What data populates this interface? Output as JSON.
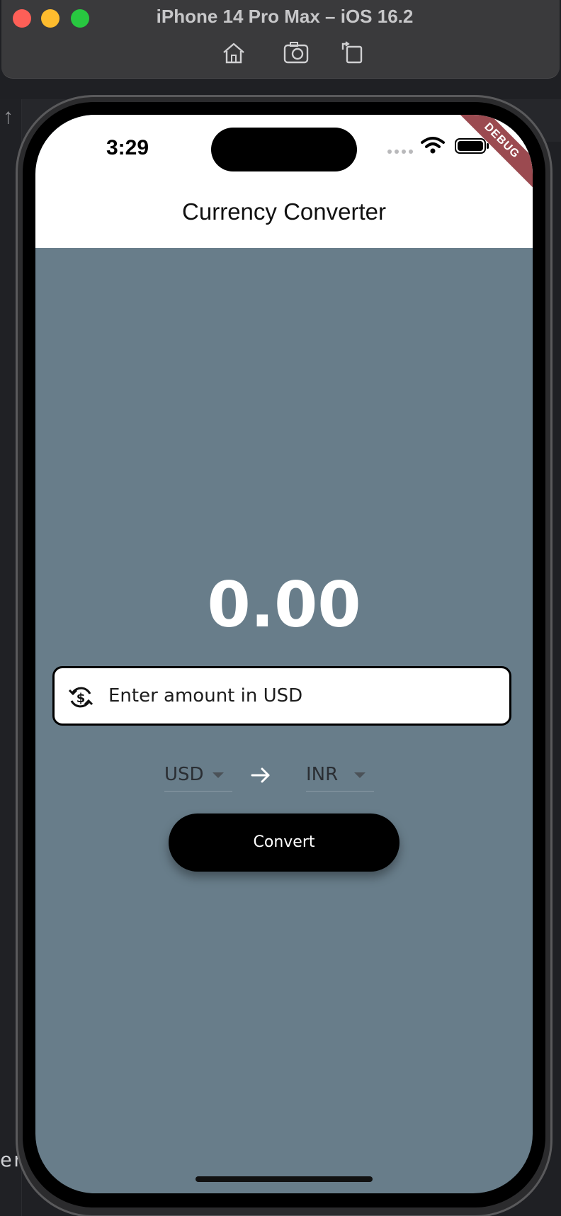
{
  "simulator": {
    "title": "iPhone 14 Pro Max – iOS 16.2",
    "tools": [
      "home-icon",
      "screenshot-icon",
      "rotate-icon"
    ]
  },
  "ide": {
    "bottom_label": "er:"
  },
  "status_bar": {
    "time": "3:29",
    "debug_banner": "DEBUG"
  },
  "app": {
    "title": "Currency Converter",
    "result": "0.00",
    "amount_placeholder": "Enter amount in USD",
    "from_currency": "USD",
    "to_currency": "INR",
    "convert_label": "Convert",
    "background_color": "#687d8a"
  }
}
